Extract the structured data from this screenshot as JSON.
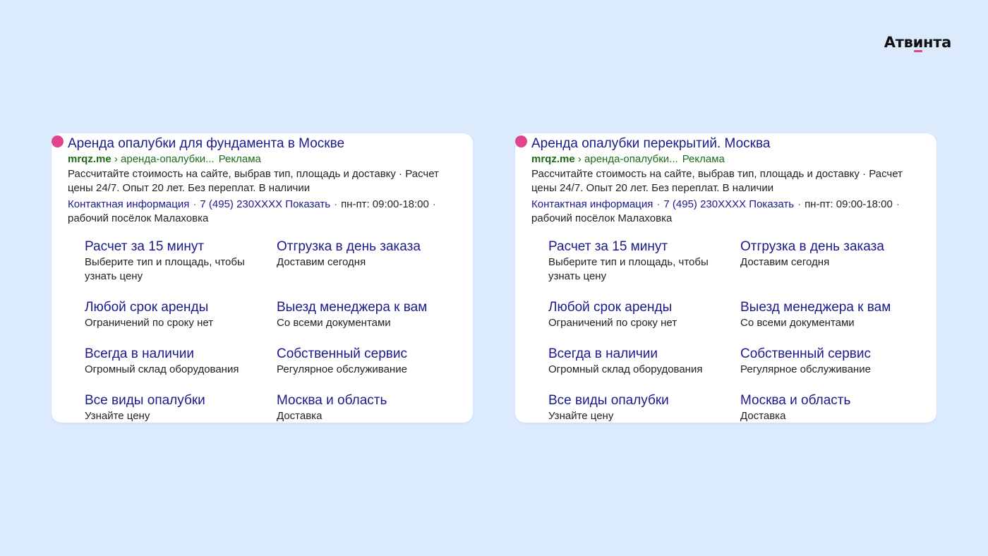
{
  "brand": {
    "name_pre": "Атв",
    "name_u": "и",
    "name_post": "нта",
    "accent": "#e0448c"
  },
  "colors": {
    "background": "#dbeafd",
    "link": "#1a1a8c",
    "green": "#1c6b1c"
  },
  "ads": [
    {
      "title": "Аренда опалубки для фундамента в Москве",
      "domain": "mrqz.me",
      "path": " › аренда-опалубки...",
      "ad_label": "Реклама",
      "description": "Рассчитайте стоимость на сайте, выбрав тип, площадь и доставку · Расчет цены 24/7. Опыт 20 лет. Без переплат. В наличии",
      "contact_label": "Контактная информация",
      "phone": "7 (495) 230XXXX",
      "phone_show": "Показать",
      "hours": "пн-пт: 09:00-18:00",
      "address": "рабочий посёлок Малаховка",
      "sitelinks": [
        {
          "title": "Расчет за 15 минут",
          "desc": "Выберите тип и площадь, чтобы узнать цену"
        },
        {
          "title": "Отгрузка в день заказа",
          "desc": "Доставим сегодня"
        },
        {
          "title": "Любой срок аренды",
          "desc": "Ограничений по сроку нет"
        },
        {
          "title": "Выезд менеджера к вам",
          "desc": "Со всеми документами"
        },
        {
          "title": "Всегда в наличии",
          "desc": "Огромный склад оборудования"
        },
        {
          "title": "Собственный сервис",
          "desc": "Регулярное обслуживание"
        },
        {
          "title": "Все виды опалубки",
          "desc": "Узнайте цену"
        },
        {
          "title": "Москва и область",
          "desc": "Доставка"
        }
      ]
    },
    {
      "title": "Аренда опалубки перекрытий. Москва",
      "domain": "mrqz.me",
      "path": " › аренда-опалубки...",
      "ad_label": "Реклама",
      "description": "Рассчитайте стоимость на сайте, выбрав тип, площадь и доставку · Расчет цены 24/7. Опыт 20 лет. Без переплат. В наличии",
      "contact_label": "Контактная информация",
      "phone": "7 (495) 230XXXX",
      "phone_show": "Показать",
      "hours": "пн-пт: 09:00-18:00",
      "address": "рабочий посёлок Малаховка",
      "sitelinks": [
        {
          "title": "Расчет за 15 минут",
          "desc": "Выберите тип и площадь, чтобы узнать цену"
        },
        {
          "title": "Отгрузка в день заказа",
          "desc": "Доставим сегодня"
        },
        {
          "title": "Любой срок аренды",
          "desc": "Ограничений по сроку нет"
        },
        {
          "title": "Выезд менеджера к вам",
          "desc": "Со всеми документами"
        },
        {
          "title": "Всегда в наличии",
          "desc": "Огромный склад оборудования"
        },
        {
          "title": "Собственный сервис",
          "desc": "Регулярное обслуживание"
        },
        {
          "title": "Все виды опалубки",
          "desc": "Узнайте цену"
        },
        {
          "title": "Москва и область",
          "desc": "Доставка"
        }
      ]
    }
  ]
}
